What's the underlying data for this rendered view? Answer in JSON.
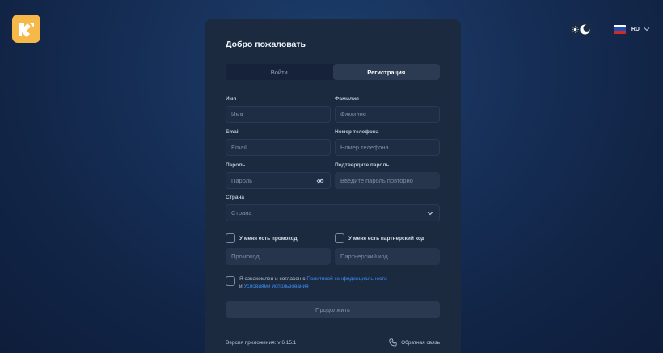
{
  "brand": {
    "logo_icon": "kite-logo-icon",
    "accent": "#f7b84a"
  },
  "header": {
    "theme_icons": [
      "sun-icon",
      "moon-icon"
    ],
    "language": {
      "code": "RU",
      "flag_colors": [
        "#ffffff",
        "#1c4fb8",
        "#d52b1e"
      ]
    }
  },
  "form": {
    "title": "Добро пожаловать",
    "tabs": [
      {
        "label": "Войти",
        "active": false
      },
      {
        "label": "Регистрация",
        "active": true
      }
    ],
    "fields": {
      "first_name": {
        "label": "Имя",
        "placeholder": "Имя"
      },
      "last_name": {
        "label": "Фамилия",
        "placeholder": "Фамилия"
      },
      "email": {
        "label": "Email",
        "placeholder": "Email"
      },
      "phone": {
        "label": "Номер телефона",
        "placeholder": "Номер телефона"
      },
      "password": {
        "label": "Пароль",
        "placeholder": "Пароль"
      },
      "confirm_password": {
        "label": "Подтвердите пароль",
        "placeholder": "Введите пароль повторно"
      },
      "country": {
        "label": "Страна",
        "placeholder": "Страна"
      },
      "promo": {
        "label": "У меня есть промокод",
        "placeholder": "Промокод"
      },
      "partner": {
        "label": "У меня есть партнерский код",
        "placeholder": "Партнерский код"
      }
    },
    "agreement": {
      "prefix": "Я ознакомлен и согласен с ",
      "privacy_link": "Политикой конфиденциальности",
      "conjunction": "и ",
      "terms_link": "Условиями использования"
    },
    "submit_label": "Продолжить",
    "version": "Версия приложения: v 6.15.1",
    "feedback_label": "Обратная связь",
    "link_color": "#3d8df5"
  }
}
